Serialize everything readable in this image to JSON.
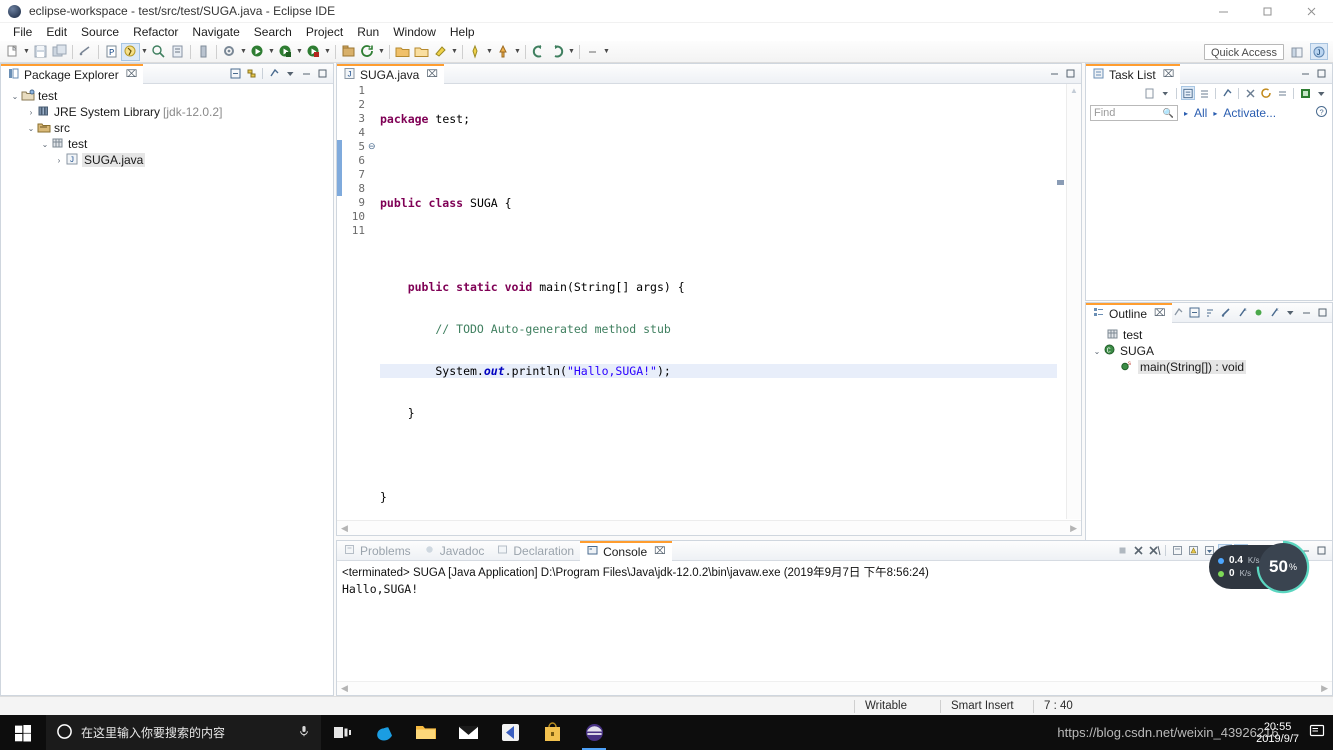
{
  "window": {
    "title": "eclipse-workspace - test/src/test/SUGA.java - Eclipse IDE",
    "app_icon": "eclipse-icon",
    "minimize": "—",
    "maximize": "❐",
    "close": "✕"
  },
  "menubar": {
    "items": [
      "File",
      "Edit",
      "Source",
      "Refactor",
      "Navigate",
      "Search",
      "Project",
      "Run",
      "Window",
      "Help"
    ]
  },
  "toolbar": {
    "quick_access_placeholder": "Quick Access",
    "icons": [
      "new-wizard-icon",
      "save-icon",
      "save-all-icon",
      "print-icon",
      "new-java-project-icon",
      "external-tools-icon",
      "debug-icon",
      "run-icon",
      "run-last-tool-icon",
      "new-class-icon",
      "search-icon",
      "open-type-icon",
      "open-task-icon",
      "next-annotation-icon",
      "previous-annotation-icon",
      "back-icon",
      "forward-icon"
    ],
    "perspective_java": "java-perspective-icon",
    "perspective_open": "open-perspective-icon"
  },
  "package_explorer": {
    "tab_label": "Package Explorer",
    "tab_close": "⌧",
    "tools": [
      "collapse-all-icon",
      "link-with-editor-icon",
      "focus-on-active-task-icon",
      "view-menu-icon",
      "minimize-icon",
      "maximize-icon"
    ],
    "tree": [
      {
        "label": "test",
        "depth": 0,
        "twisty": "expanded",
        "icon": "java-project-icon",
        "selected": false
      },
      {
        "label": "JRE System Library",
        "suffix": " [jdk-12.0.2]",
        "depth": 1,
        "twisty": "collapsed",
        "icon": "library-icon",
        "selected": false
      },
      {
        "label": "src",
        "depth": 1,
        "twisty": "expanded",
        "icon": "source-folder-icon",
        "selected": false
      },
      {
        "label": "test",
        "depth": 2,
        "twisty": "expanded",
        "icon": "package-icon",
        "selected": false
      },
      {
        "label": "SUGA.java",
        "depth": 3,
        "twisty": "collapsed",
        "icon": "java-file-icon",
        "selected": true
      }
    ]
  },
  "editor": {
    "tab_label": "SUGA.java",
    "tab_close": "⌧",
    "tab_icon": "java-file-icon",
    "minimize": "−",
    "maximize": "❐",
    "lines": [
      {
        "n": "1",
        "marker": "",
        "current": false
      },
      {
        "n": "2",
        "marker": "",
        "current": false
      },
      {
        "n": "3",
        "marker": "",
        "current": false
      },
      {
        "n": "4",
        "marker": "",
        "current": false
      },
      {
        "n": "5",
        "marker": "⊖",
        "current": false
      },
      {
        "n": "6",
        "marker": "",
        "current": false
      },
      {
        "n": "7",
        "marker": "",
        "current": true
      },
      {
        "n": "8",
        "marker": "",
        "current": false
      },
      {
        "n": "9",
        "marker": "",
        "current": false
      },
      {
        "n": "10",
        "marker": "",
        "current": false
      },
      {
        "n": "11",
        "marker": "",
        "current": false
      }
    ],
    "code_lines": [
      [
        {
          "t": "package ",
          "c": "kw"
        },
        {
          "t": "test;",
          "c": ""
        }
      ],
      [],
      [
        {
          "t": "public class ",
          "c": "kw"
        },
        {
          "t": "SUGA {",
          "c": ""
        }
      ],
      [],
      [
        {
          "t": "    public static void ",
          "c": "kw"
        },
        {
          "t": "main(String[] args) {",
          "c": ""
        }
      ],
      [
        {
          "t": "        // TODO Auto-generated method stub",
          "c": "cmt"
        }
      ],
      [
        {
          "t": "        System.",
          "c": ""
        },
        {
          "t": "out",
          "c": "fld"
        },
        {
          "t": ".println(",
          "c": ""
        },
        {
          "t": "\"Hallo,SUGA!\"",
          "c": "str"
        },
        {
          "t": ");",
          "c": ""
        }
      ],
      [
        {
          "t": "    }",
          "c": ""
        }
      ],
      [],
      [
        {
          "t": "}",
          "c": ""
        }
      ],
      []
    ]
  },
  "console": {
    "tabs": [
      {
        "label": "Problems",
        "icon": "problems-icon",
        "active": false
      },
      {
        "label": "Javadoc",
        "icon": "javadoc-icon",
        "active": false
      },
      {
        "label": "Declaration",
        "icon": "declaration-icon",
        "active": false
      },
      {
        "label": "Console",
        "icon": "console-icon",
        "active": true
      }
    ],
    "tab_close": "⌧",
    "header_line": "<terminated> SUGA [Java Application] D:\\Program Files\\Java\\jdk-12.0.2\\bin\\javaw.exe (2019年9月7日 下午8:56:24)",
    "output_line": "Hallo,SUGA!",
    "tools": [
      "terminate-icon",
      "remove-launch-icon",
      "remove-all-terminated-icon",
      "clear-console-icon",
      "toggle-show-on-error-icon",
      "toggle-show-on-output-icon",
      "pin-console-icon",
      "display-selected-console-icon",
      "open-console-icon",
      "scroll-lock-icon",
      "word-wrap-icon",
      "view-menu-icon",
      "minimize-icon",
      "maximize-icon"
    ]
  },
  "task_list": {
    "tab_label": "Task List",
    "tab_close": "⌧",
    "tools": [
      "new-task-icon",
      "dropdown-icon",
      "categorized-presentation-icon",
      "scheduled-presentation-icon",
      "focus-on-workweek-icon",
      "synchronize-changed-icon",
      "collapse-all-icon",
      "expand-all-icon",
      "view-menu-icon"
    ],
    "find_placeholder": "Find",
    "find_value": "",
    "filter_all": "All",
    "filter_activate": "Activate...",
    "help_icon": "help-icon",
    "minimize": "−",
    "maximize": "❐"
  },
  "outline": {
    "tab_label": "Outline",
    "tab_close": "⌧",
    "tools": [
      "focus-icon",
      "collapse-all-icon",
      "sort-icon",
      "hide-fields-icon",
      "hide-static-icon",
      "hide-nonpublic-icon",
      "hide-local-types-icon",
      "view-menu-icon",
      "minimize-icon",
      "maximize-icon"
    ],
    "tree": [
      {
        "label": "test",
        "depth": 1,
        "twisty": "",
        "icon": "package-icon",
        "selected": false
      },
      {
        "label": "SUGA",
        "depth": 0,
        "twisty": "expanded",
        "icon": "class-icon",
        "selected": false
      },
      {
        "label": "main(String[]) : void",
        "depth": 2,
        "twisty": "",
        "icon": "public-method-icon",
        "selected": true
      }
    ]
  },
  "statusbar": {
    "writable": "Writable",
    "insert_mode": "Smart Insert",
    "cursor_position": "7 : 40"
  },
  "taskbar": {
    "start_icon": "windows-start-icon",
    "search_placeholder": "在这里输入你要搜索的内容",
    "search_icon": "cortana-circle-icon",
    "mic_icon": "microphone-icon",
    "apps": [
      {
        "name": "task-view-icon",
        "open": false
      },
      {
        "name": "edge-icon",
        "open": false
      },
      {
        "name": "file-explorer-icon",
        "open": false
      },
      {
        "name": "mail-icon",
        "open": false
      },
      {
        "name": "flipboard-icon",
        "open": false
      },
      {
        "name": "microsoft-store-icon",
        "open": false
      },
      {
        "name": "eclipse-icon",
        "open": true
      }
    ],
    "clock_time": "20:55",
    "clock_date": "2019/9/7",
    "notification_icon": "action-center-icon",
    "watermark": "https://blog.csdn.net/weixin_43926216"
  },
  "speed_widget": {
    "upload": "0.4",
    "upload_unit": "K/s",
    "download": "0",
    "download_unit": "K/s",
    "percent": "50",
    "percent_unit": "%",
    "up_color": "#4da6ff",
    "down_color": "#7ed957"
  },
  "colors": {
    "accent": "#ff9d2f",
    "panel_border": "#cfd6de",
    "link": "#2a5db0",
    "selection": "#e8eefa",
    "change_bar": "#7faadc"
  }
}
